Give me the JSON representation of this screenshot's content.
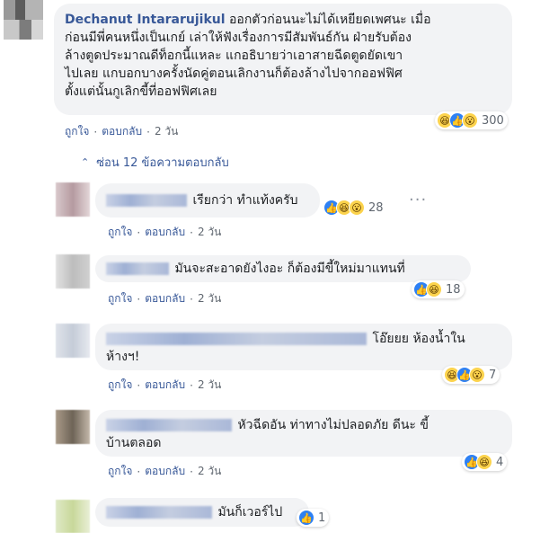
{
  "comment": {
    "author": "Dechanut Intararujikul",
    "lines": [
      "ออกตัวก่อนนะไม่ได้เหยียดเพศนะ เมื่อ",
      "ก่อนมีพี่คนหนึ่งเป็นเกย์ เล่าให้ฟังเรื่องการมีสัมพันธ์กัน ฝ่ายรับต้อง",
      "ล้างตูดประมาณดีท็อกนี้แหละ แกอธิบายว่าเอาสายฉีดตูดยัดเขา",
      "ไปเลย แกบอกบางครั้งนัดคู่ตอนเลิกงานก็ต้องล้างไปจากออฟฟิศ",
      "ตั้งแต่นั้นกูเลิกขี้ที่ออฟฟิศเลย"
    ],
    "reaction_count": "300",
    "meta": {
      "like": "ถูกใจ",
      "reply": "ตอบกลับ",
      "time": "2 วัน",
      "dot": "·"
    }
  },
  "replies_toggle": {
    "chevron": "⌃",
    "label": "ซ่อน 12 ข้อความตอบกลับ"
  },
  "replies": [
    {
      "text": "เรียกว่า ทำแท้งครับ",
      "reaction_count": "28",
      "meta": {
        "like": "ถูกใจ",
        "reply": "ตอบกลับ",
        "time": "2 วัน",
        "dot": "·"
      }
    },
    {
      "text": "มันจะสะอาดยังไงอะ ก็ต้องมีขี้ใหม่มาแทนที่",
      "reaction_count": "18",
      "meta": {
        "like": "ถูกใจ",
        "reply": "ตอบกลับ",
        "time": "2 วัน",
        "dot": "·"
      }
    },
    {
      "text_line1": "โอ๊ยยย ห้องน้ำใน",
      "text_line2": "ห้างฯ!",
      "reaction_count": "7",
      "meta": {
        "like": "ถูกใจ",
        "reply": "ตอบกลับ",
        "time": "2 วัน",
        "dot": "·"
      }
    },
    {
      "text_line1": "หัวฉีดอัน ท่าทางไม่ปลอดภัย ดีนะ ขี้",
      "text_line2": "บ้านตลอด",
      "reaction_count": "4",
      "meta": {
        "like": "ถูกใจ",
        "reply": "ตอบกลับ",
        "time": "2 วัน",
        "dot": "·"
      }
    },
    {
      "text": "มันก็เวอร์ไป",
      "reaction_count": "1"
    }
  ],
  "colors": {
    "link": "#385898",
    "bubble": "#f2f3f5",
    "like": "#2e81f4",
    "emoji": "#fcd34d"
  },
  "icons": {
    "like": "thumbs-up-icon",
    "haha": "laughing-face-icon",
    "wow": "surprised-face-icon",
    "more": "more-options-icon"
  }
}
